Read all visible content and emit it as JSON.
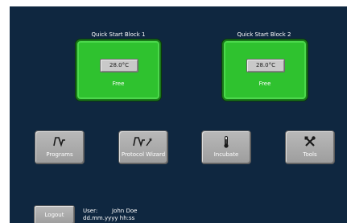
{
  "blocks": [
    {
      "title": "Quick Start  Block 1",
      "temperature": "28.0°C",
      "status": "Free"
    },
    {
      "title": "Quick Start  Block 2",
      "temperature": "28.0°C",
      "status": "Free"
    }
  ],
  "buttons": {
    "programs": {
      "label": "Programs",
      "icon": "program-curve-icon"
    },
    "protocol_wizard": {
      "label": "Protocol Wizard",
      "icon": "wizard-curve-icon"
    },
    "incubate": {
      "label": "Incubate",
      "icon": "thermometer-icon"
    },
    "tools": {
      "label": "Tools",
      "icon": "tools-icon"
    }
  },
  "footer": {
    "logout_label": "Logout",
    "user_label": "User:",
    "user_name": "John Doe",
    "datetime": "dd.mm.yyyy hh:ss"
  },
  "colors": {
    "background": "#0f2740",
    "block_free": "#2fc22f",
    "button": "#a9a9a9"
  }
}
